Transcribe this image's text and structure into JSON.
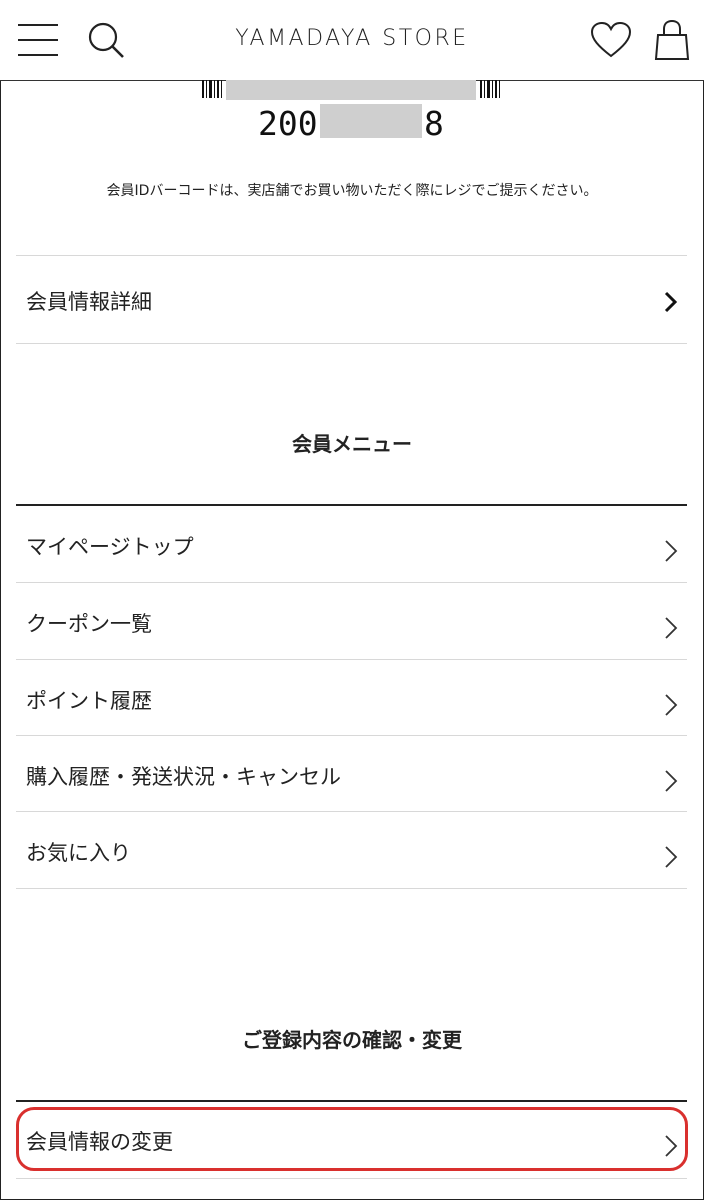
{
  "header": {
    "brand": "YAMADAYA STORE",
    "icons": [
      "menu-icon",
      "search-icon",
      "heart-icon",
      "shopping-bag-icon"
    ]
  },
  "membership": {
    "id_prefix": "200",
    "id_suffix": "8",
    "barcode_note": "会員IDバーコードは、実店舗でお買い物いただく際にレジでご提示ください。"
  },
  "details_link": {
    "label": "会員情報詳細"
  },
  "member_menu": {
    "title": "会員メニュー",
    "items": [
      {
        "label": "マイページトップ"
      },
      {
        "label": "クーポン一覧"
      },
      {
        "label": "ポイント履歴"
      },
      {
        "label": "購入履歴・発送状況・キャンセル"
      },
      {
        "label": "お気に入り"
      }
    ]
  },
  "registration": {
    "title": "ご登録内容の確認・変更",
    "items": [
      {
        "label": "会員情報の変更"
      }
    ]
  },
  "colors": {
    "highlight": "#d9302e",
    "text": "#222222",
    "divider": "#d8d8d8"
  }
}
